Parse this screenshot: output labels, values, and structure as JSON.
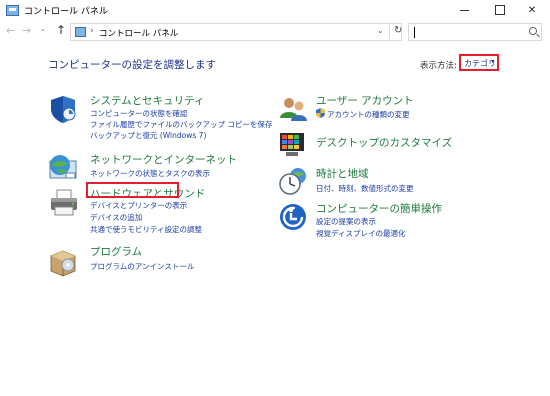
{
  "window": {
    "title": "コントロール パネル"
  },
  "address_bar": {
    "path": "コントロール パネル",
    "separator": "›"
  },
  "header": {
    "heading": "コンピューターの設定を調整します",
    "view_label": "表示方法:",
    "view_value": "カテゴリ"
  },
  "categories": {
    "system": {
      "title": "システムとセキュリティ",
      "links": [
        "コンピューターの状態を確認",
        "ファイル履歴でファイルのバックアップ コピーを保存",
        "バックアップと復元 (Windows 7)"
      ]
    },
    "network": {
      "title": "ネットワークとインターネット",
      "links": [
        "ネットワークの状態とタスクの表示"
      ]
    },
    "hardware": {
      "title": "ハードウェアとサウンド",
      "links": [
        "デバイスとプリンターの表示",
        "デバイスの追加",
        "共通で使うモビリティ設定の調整"
      ]
    },
    "programs": {
      "title": "プログラム",
      "links": [
        "プログラムのアンインストール"
      ]
    },
    "user": {
      "title": "ユーザー アカウント",
      "links": [
        "アカウントの種類の変更"
      ]
    },
    "desktop": {
      "title": "デスクトップのカスタマイズ",
      "links": []
    },
    "clock": {
      "title": "時計と地域",
      "links": [
        "日付、時刻、数値形式の変更"
      ]
    },
    "access": {
      "title": "コンピューターの簡単操作",
      "links": [
        "設定の提案の表示",
        "視覚ディスプレイの最適化"
      ]
    }
  },
  "icons": {
    "app": "control-panel-icon",
    "back": "back-arrow-icon",
    "forward": "forward-arrow-icon",
    "up": "up-arrow-icon",
    "refresh": "refresh-icon",
    "search": "search-icon",
    "system": "shield-icon",
    "network": "globe-network-icon",
    "hardware": "printer-icon",
    "programs": "program-box-icon",
    "user": "users-icon",
    "desktop": "desktop-color-icon",
    "clock": "clock-globe-icon",
    "access": "accessibility-icon",
    "admin_shield": "uac-shield-icon"
  },
  "colors": {
    "title_green": "#1d7a3c",
    "link_blue": "#1a3da8",
    "heading_blue": "#1e3287",
    "highlight_red": "#e0202c"
  }
}
